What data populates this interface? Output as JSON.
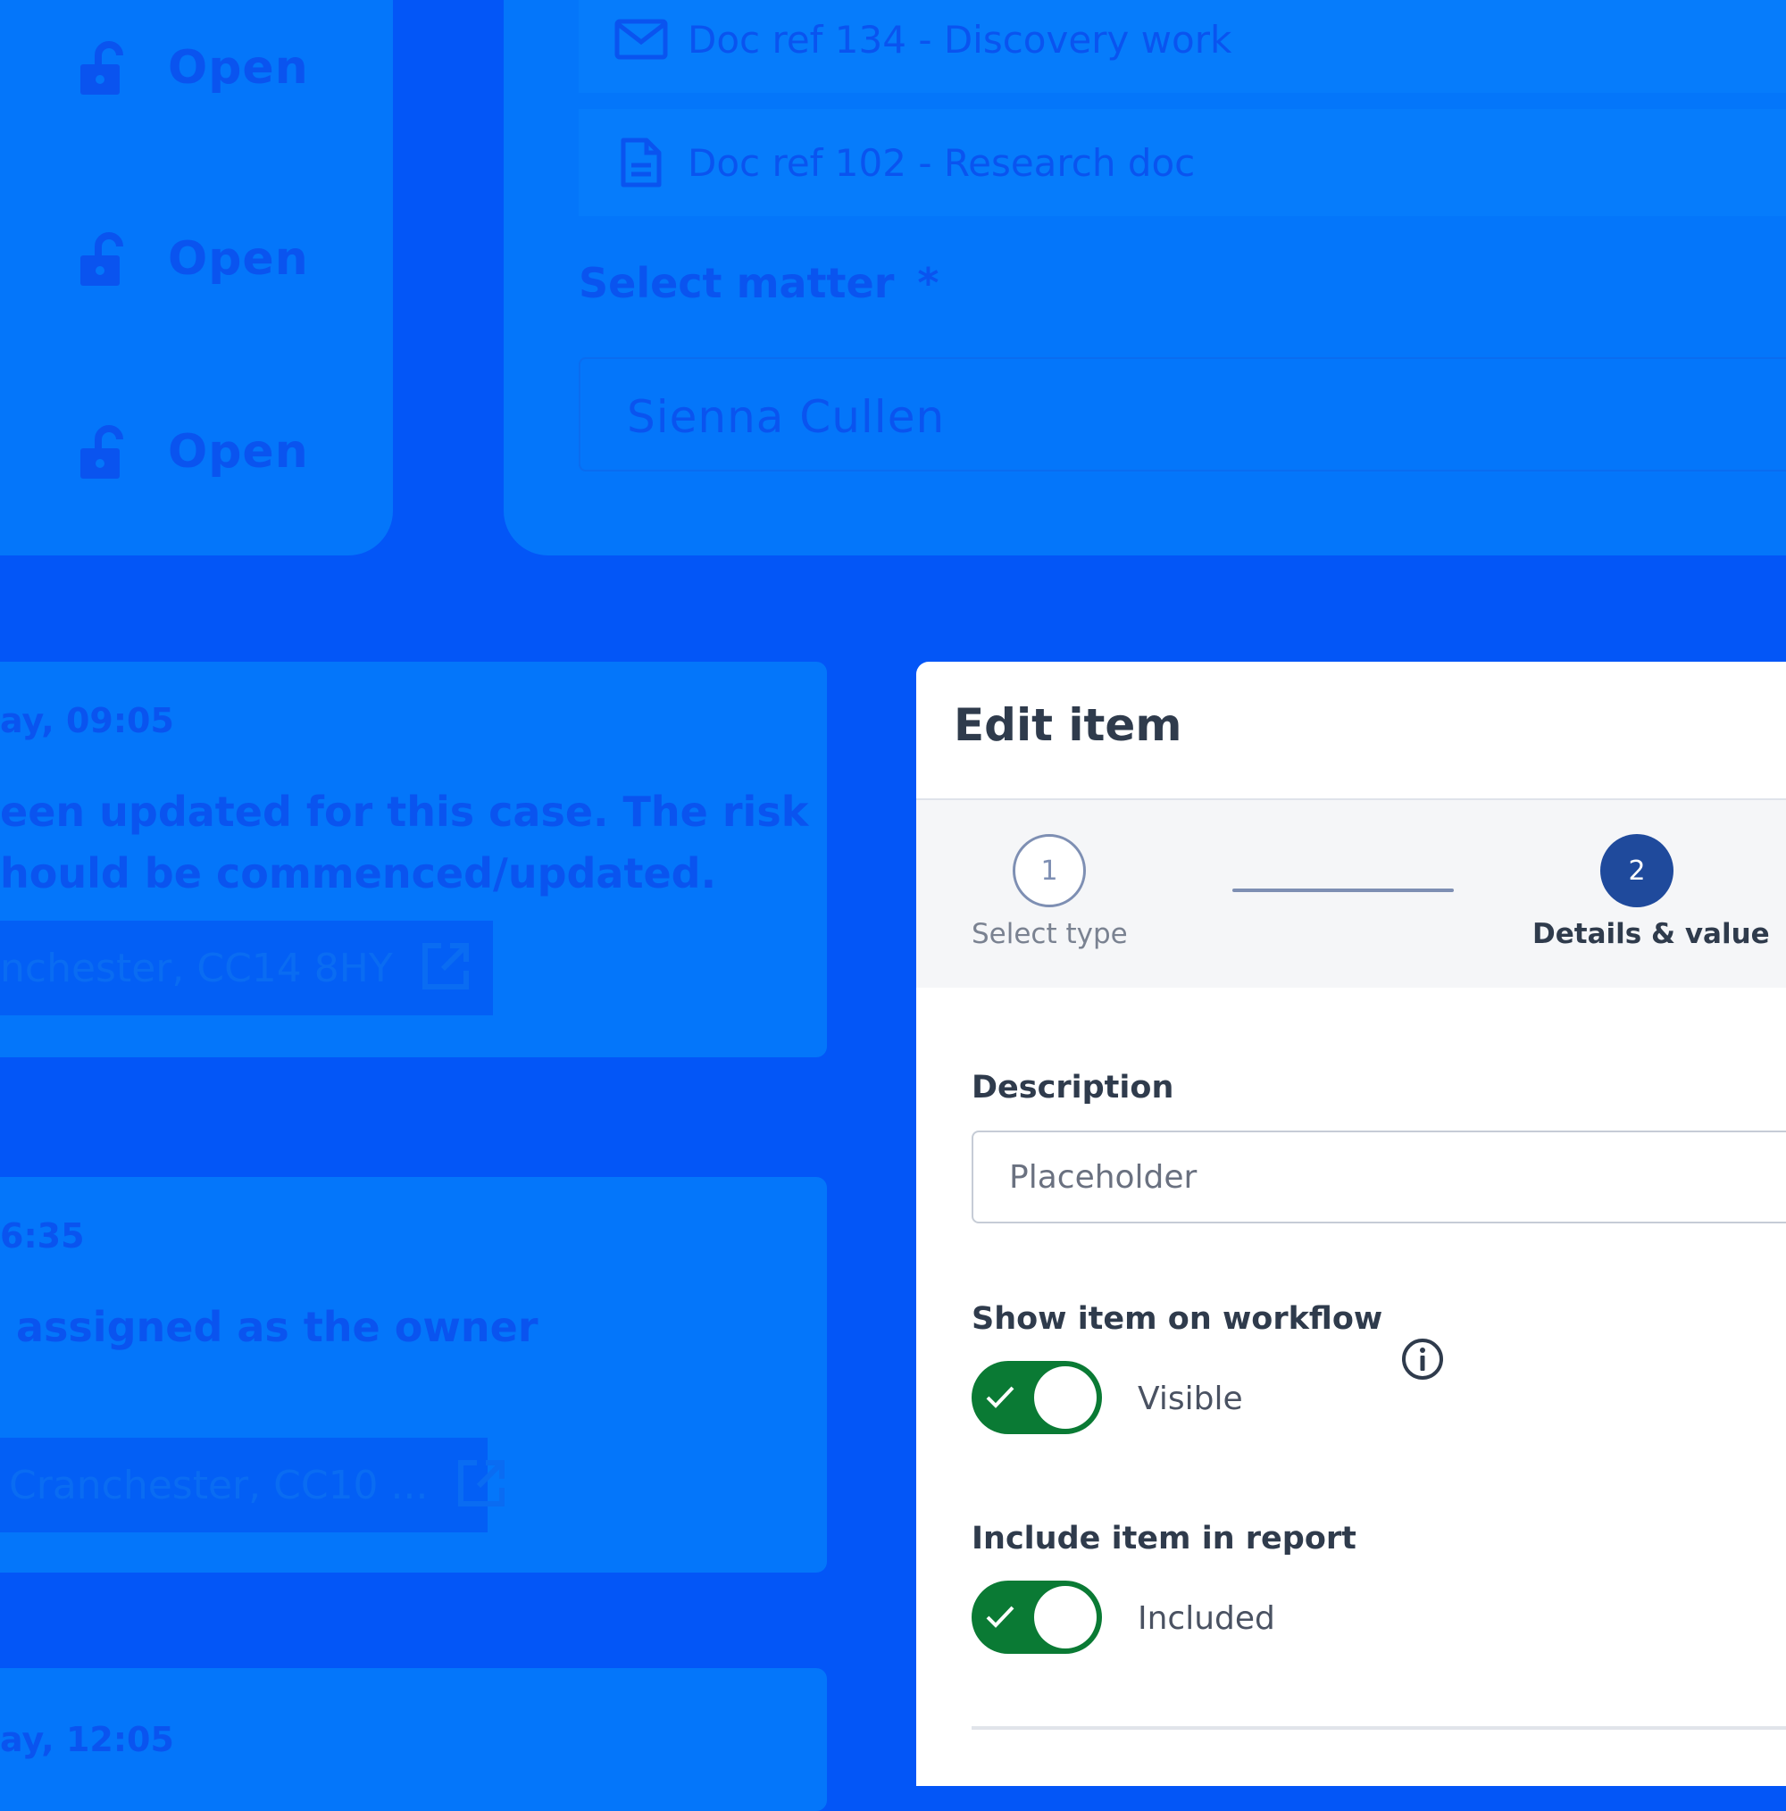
{
  "background": {
    "status_rows": [
      {
        "label": "Open",
        "icon": "unlock-icon"
      },
      {
        "label": "Open",
        "icon": "unlock-icon"
      },
      {
        "label": "Open",
        "icon": "unlock-icon"
      }
    ],
    "documents": [
      {
        "label": "Doc ref 134 - Discovery work",
        "icon": "mail-icon"
      },
      {
        "label": "Doc ref 102 - Research doc",
        "icon": "document-icon"
      }
    ],
    "matter": {
      "label": "Select matter",
      "required_mark": "*",
      "value": "Sienna Cullen"
    },
    "activity": [
      {
        "time": "ay, 09:05",
        "lines": [
          "een updated for this case. The risk",
          "hould be commenced/updated."
        ],
        "address": "nchester, CC14 8HY",
        "icon": "external-link-icon"
      },
      {
        "time": "6:35",
        "lines": [
          "assigned as the owner"
        ],
        "address": "Cranchester, CC10 ...",
        "icon": "external-link-icon"
      },
      {
        "time": "ay, 12:05",
        "lines": [],
        "address": "",
        "icon": ""
      }
    ]
  },
  "modal": {
    "title": "Edit item",
    "steps": [
      {
        "number": "1",
        "label": "Select type",
        "state": "completed"
      },
      {
        "number": "2",
        "label": "Details & value",
        "state": "active"
      }
    ],
    "description": {
      "label": "Description",
      "placeholder": "Placeholder"
    },
    "show_on_workflow": {
      "label": "Show item on workflow",
      "state_text": "Visible",
      "on": true,
      "info_icon": "info-icon"
    },
    "include_in_report": {
      "label": "Include item in report",
      "state_text": "Included",
      "on": true
    }
  },
  "colors": {
    "background": "#0356f7",
    "panel": "#0476fa",
    "toggle_on": "#0a7a34",
    "step_active": "#1f4a9c",
    "title_text": "#2f3b4c"
  }
}
